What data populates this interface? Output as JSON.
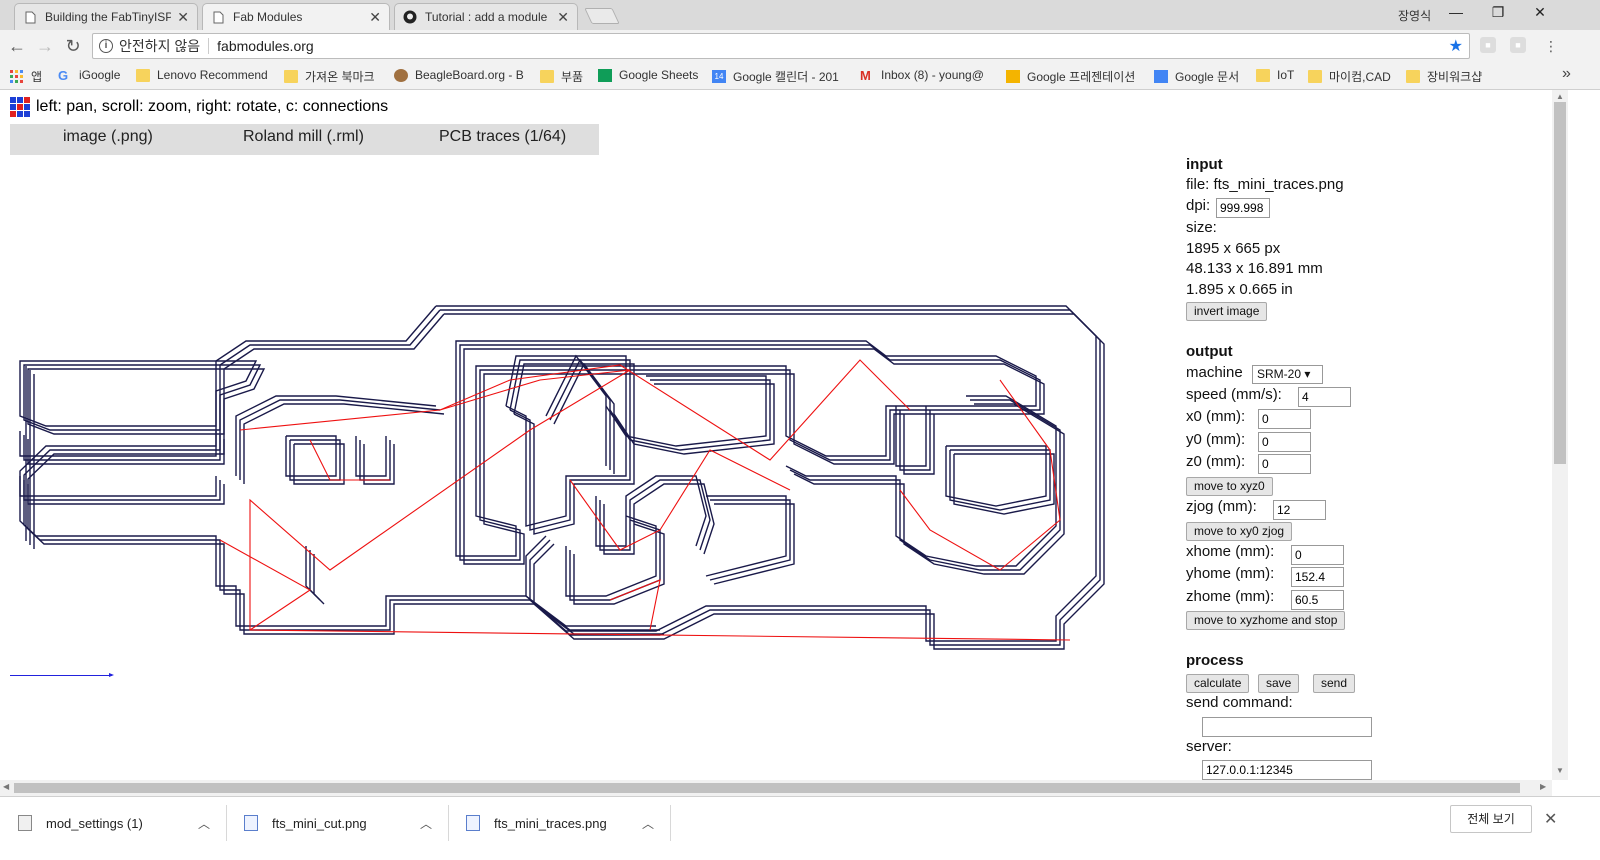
{
  "browser": {
    "tabs": [
      {
        "title": "Building the FabTinyISP",
        "icon": "page-icon"
      },
      {
        "title": "Fab Modules",
        "icon": "page-icon"
      },
      {
        "title": "Tutorial : add a module",
        "icon": "github-icon"
      }
    ],
    "profile_name": "장영식",
    "security_text": "안전하지 않음",
    "url": "fabmodules.org",
    "bookmarks": [
      {
        "label": "앱",
        "icon": "apps-icon"
      },
      {
        "label": "iGoogle",
        "icon": "google-icon"
      },
      {
        "label": "Lenovo Recommend",
        "icon": "folder-icon"
      },
      {
        "label": "가져온 북마크",
        "icon": "folder-icon"
      },
      {
        "label": "BeagleBoard.org - B",
        "icon": "beagle-icon"
      },
      {
        "label": "부품",
        "icon": "folder-icon"
      },
      {
        "label": "Google Sheets",
        "icon": "sheets-icon"
      },
      {
        "label": "Google 캘린더 - 201",
        "icon": "calendar-icon"
      },
      {
        "label": "Inbox (8) - young@",
        "icon": "gmail-icon"
      },
      {
        "label": "Google 프레젠테이션",
        "icon": "slides-icon"
      },
      {
        "label": "Google 문서",
        "icon": "docs-icon"
      },
      {
        "label": "IoT",
        "icon": "folder-icon"
      },
      {
        "label": "마이컴,CAD",
        "icon": "folder-icon"
      },
      {
        "label": "장비워크샵",
        "icon": "folder-icon"
      }
    ],
    "calendar_day": "14"
  },
  "page": {
    "hint": "left: pan, scroll: zoom, right: rotate, c: connections",
    "format_bar": {
      "input_format": "image (.png)",
      "output_format": "Roland mill (.rml)",
      "process": "PCB traces (1/64)"
    },
    "input": {
      "heading": "input",
      "file_label": "file: fts_mini_traces.png",
      "dpi_label": "dpi:",
      "dpi_value": "999.998",
      "size_label": "size:",
      "size_px": "1895 x 665 px",
      "size_mm": "48.133 x 16.891 mm",
      "size_in": "1.895 x 0.665 in",
      "invert_button": "invert image"
    },
    "output": {
      "heading": "output",
      "machine_label": "machine",
      "machine_value": "SRM-20 ▾",
      "speed_label": "speed (mm/s):",
      "speed_value": "4",
      "x0_label": "x0 (mm):",
      "x0_value": "0",
      "y0_label": "y0 (mm):",
      "y0_value": "0",
      "z0_label": "z0 (mm):",
      "z0_value": "0",
      "move_xyz0_button": "move to xyz0",
      "zjog_label": "zjog (mm):",
      "zjog_value": "12",
      "move_xy0_zjog_button": "move to xy0 zjog",
      "xhome_label": "xhome (mm):",
      "xhome_value": "0",
      "yhome_label": "yhome (mm):",
      "yhome_value": "152.4",
      "zhome_label": "zhome (mm):",
      "zhome_value": "60.5",
      "move_home_button": "move to xyzhome and stop"
    },
    "process": {
      "heading": "process",
      "calculate_button": "calculate",
      "save_button": "save",
      "send_button": "send",
      "send_command_label": "send command:",
      "send_command_value": "",
      "server_label": "server:",
      "server_value": "127.0.0.1:12345"
    }
  },
  "downloads": {
    "items": [
      {
        "name": "mod_settings (1)"
      },
      {
        "name": "fts_mini_cut.png"
      },
      {
        "name": "fts_mini_traces.png"
      }
    ],
    "show_all": "전체 보기"
  },
  "colors": {
    "toolpath": "#1a1a4a",
    "connections": "#ee1111",
    "scale_bar": "#2222dd"
  }
}
